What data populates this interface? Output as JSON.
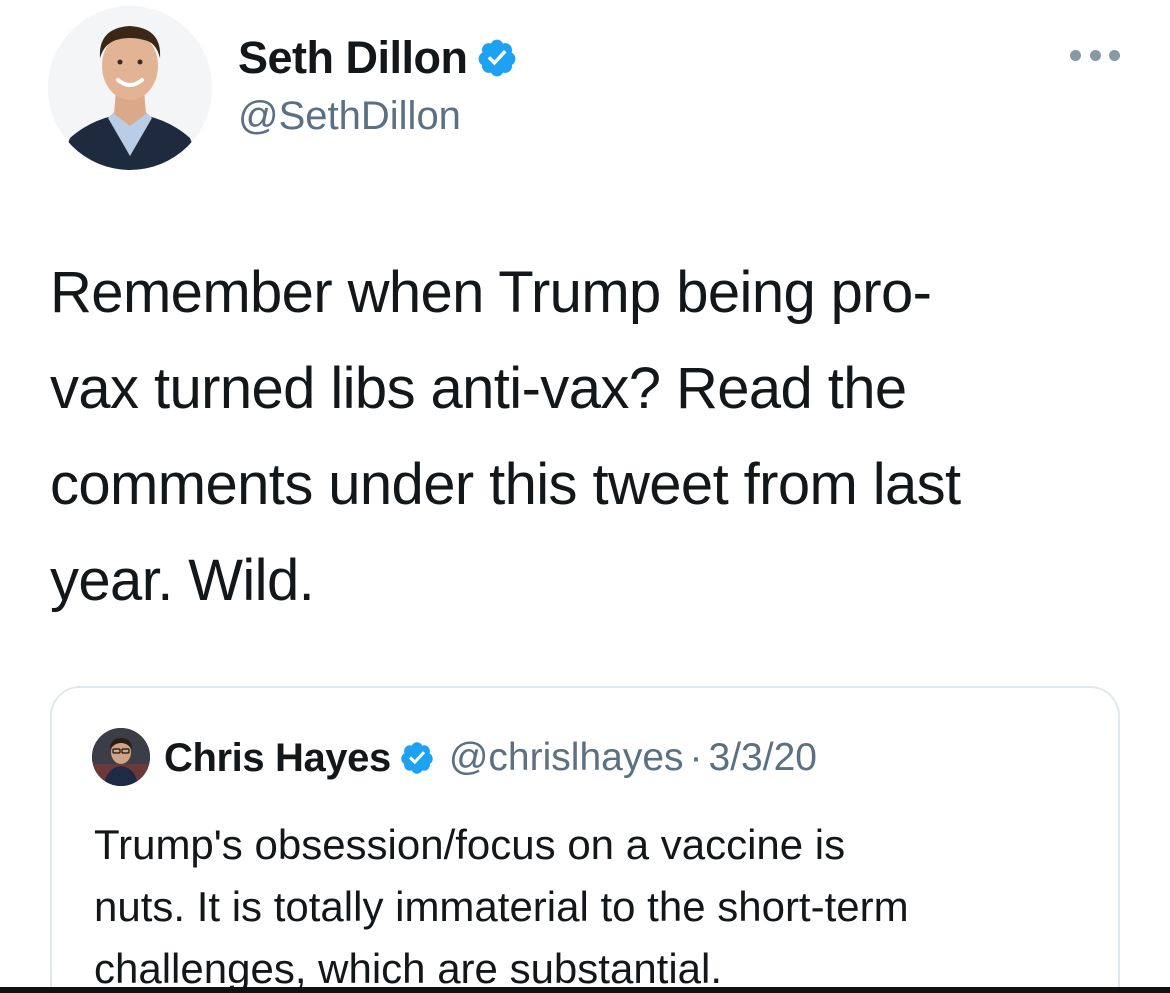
{
  "author": {
    "display_name": "Seth Dillon",
    "handle": "@SethDillon",
    "verified": true
  },
  "tweet": {
    "text": "Remember when Trump being pro-\nvax turned libs anti-vax? Read the\ncomments under this tweet from last\nyear. Wild."
  },
  "quoted_tweet": {
    "display_name": "Chris Hayes",
    "handle": "@chrislhayes",
    "separator": "·",
    "date": "3/3/20",
    "verified": true,
    "text": "Trump's obsession/focus on a vaccine is\nnuts. It is totally immaterial to the short-term\nchallenges, which are substantial."
  },
  "icons": {
    "verified": "verified-badge-icon",
    "more": "more-options-icon"
  },
  "colors": {
    "verified_blue": "#1da1f2",
    "secondary_text": "#5b7083",
    "border": "#e1e8ed",
    "primary_text": "#14171a"
  }
}
